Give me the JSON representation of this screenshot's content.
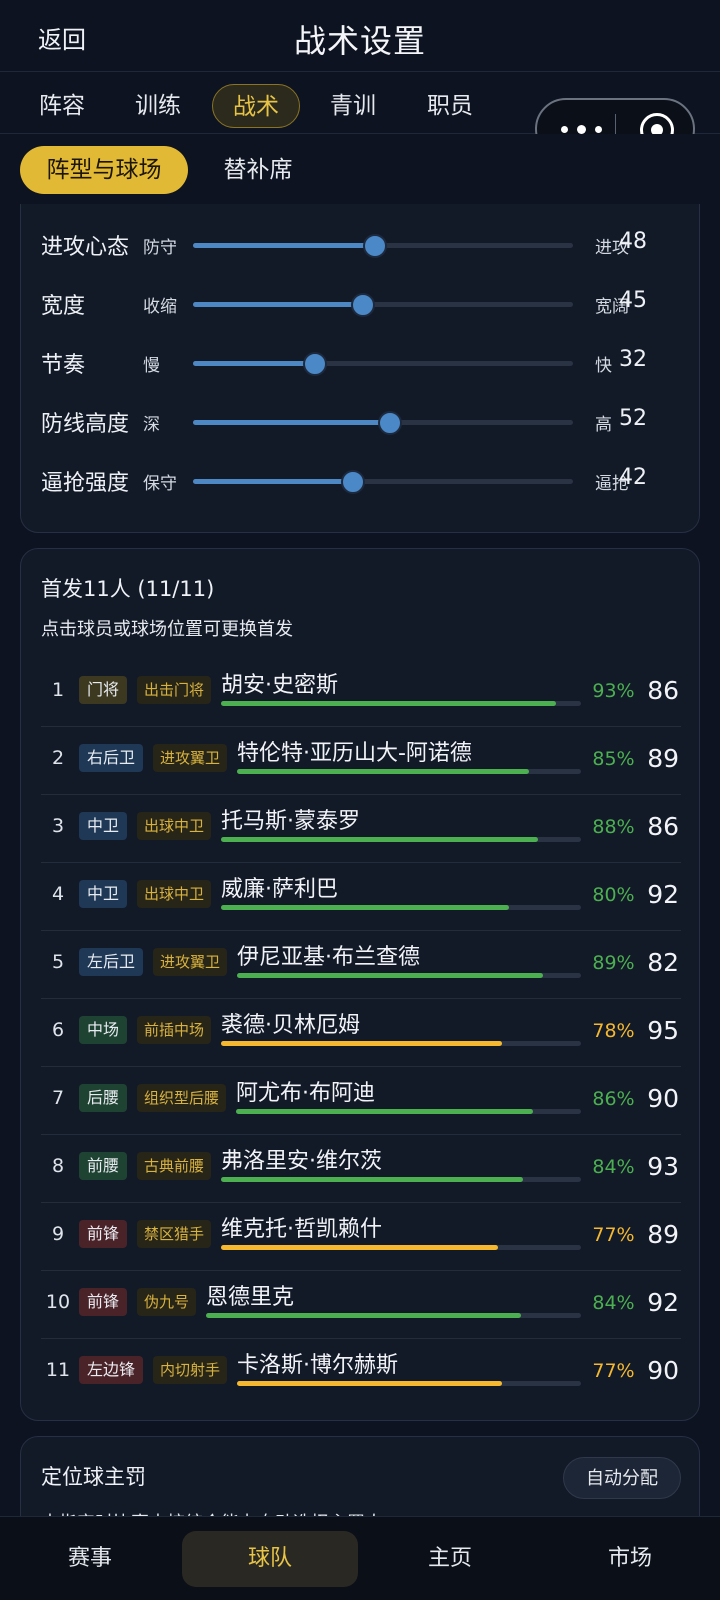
{
  "header": {
    "back_label": "返回",
    "title": "战术设置"
  },
  "tabs": [
    "阵容",
    "训练",
    "战术",
    "青训",
    "职员"
  ],
  "active_tab": "战术",
  "subtabs": [
    "阵型与球场",
    "替补席"
  ],
  "active_subtab": "阵型与球场",
  "sliders": [
    {
      "label": "进攻心态",
      "min_label": "防守",
      "max_label": "进攻",
      "value": "48"
    },
    {
      "label": "宽度",
      "min_label": "收缩",
      "max_label": "宽阔",
      "value": "45"
    },
    {
      "label": "节奏",
      "min_label": "慢",
      "max_label": "快",
      "value": "32"
    },
    {
      "label": "防线高度",
      "min_label": "深",
      "max_label": "高",
      "value": "52"
    },
    {
      "label": "逼抢强度",
      "min_label": "保守",
      "max_label": "逼抢",
      "value": "42"
    }
  ],
  "lineup": {
    "title": "首发11人 (11/11)",
    "hint": "点击球员或球场位置可更换首发",
    "players": [
      {
        "num": "1",
        "position": "门将",
        "pos_group": "gk",
        "role": "出击门将",
        "name": "胡安·史密斯",
        "fit": "93%",
        "fit_value": 93,
        "rating": "86"
      },
      {
        "num": "2",
        "position": "右后卫",
        "pos_group": "def",
        "role": "进攻翼卫",
        "name": "特伦特·亚历山大-阿诺德",
        "fit": "85%",
        "fit_value": 85,
        "rating": "89"
      },
      {
        "num": "3",
        "position": "中卫",
        "pos_group": "def",
        "role": "出球中卫",
        "name": "托马斯·蒙泰罗",
        "fit": "88%",
        "fit_value": 88,
        "rating": "86"
      },
      {
        "num": "4",
        "position": "中卫",
        "pos_group": "def",
        "role": "出球中卫",
        "name": "威廉·萨利巴",
        "fit": "80%",
        "fit_value": 80,
        "rating": "92"
      },
      {
        "num": "5",
        "position": "左后卫",
        "pos_group": "def",
        "role": "进攻翼卫",
        "name": "伊尼亚基·布兰查德",
        "fit": "89%",
        "fit_value": 89,
        "rating": "82"
      },
      {
        "num": "6",
        "position": "中场",
        "pos_group": "mid",
        "role": "前插中场",
        "name": "裘德·贝林厄姆",
        "fit": "78%",
        "fit_value": 78,
        "rating": "95"
      },
      {
        "num": "7",
        "position": "后腰",
        "pos_group": "mid",
        "role": "组织型后腰",
        "name": "阿尤布·布阿迪",
        "fit": "86%",
        "fit_value": 86,
        "rating": "90"
      },
      {
        "num": "8",
        "position": "前腰",
        "pos_group": "mid",
        "role": "古典前腰",
        "name": "弗洛里安·维尔茨",
        "fit": "84%",
        "fit_value": 84,
        "rating": "93"
      },
      {
        "num": "9",
        "position": "前锋",
        "pos_group": "fwd",
        "role": "禁区猎手",
        "name": "维克托·哲凯赖什",
        "fit": "77%",
        "fit_value": 77,
        "rating": "89"
      },
      {
        "num": "10",
        "position": "前锋",
        "pos_group": "fwd",
        "role": "伪九号",
        "name": "恩德里克",
        "fit": "84%",
        "fit_value": 84,
        "rating": "92"
      },
      {
        "num": "11",
        "position": "左边锋",
        "pos_group": "fwd",
        "role": "内切射手",
        "name": "卡洛斯·博尔赫斯",
        "fit": "77%",
        "fit_value": 77,
        "rating": "90"
      }
    ]
  },
  "set_pieces": {
    "title": "定位球主罚",
    "auto_button": "自动分配",
    "hint": "未指定时比赛中按综合能力自动选择主罚人"
  },
  "bottom_nav": [
    "赛事",
    "球队",
    "主页",
    "市场"
  ],
  "active_nav": "球队",
  "colors": {
    "accent": "#e2b935",
    "fit_high": "#4caf50",
    "fit_low": "#f5b82e",
    "slider": "#4d87c4"
  }
}
